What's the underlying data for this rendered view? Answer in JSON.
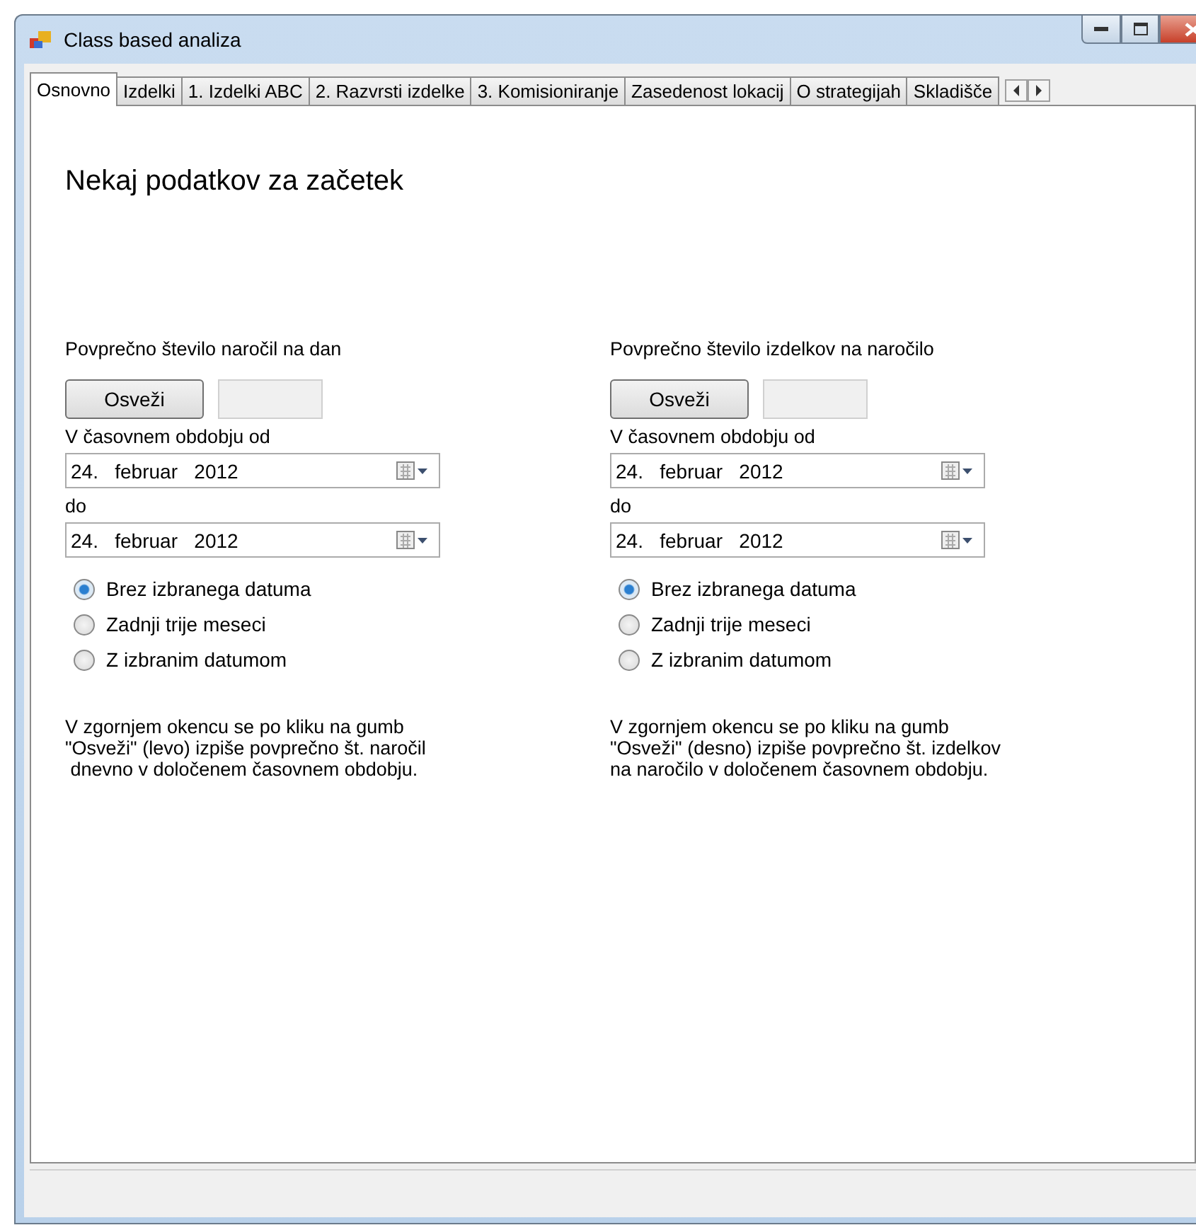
{
  "window": {
    "title": "Class based analiza"
  },
  "tabs": [
    {
      "label": "Osnovno",
      "selected": true
    },
    {
      "label": "Izdelki",
      "selected": false
    },
    {
      "label": "1. Izdelki ABC",
      "selected": false
    },
    {
      "label": "2. Razvrsti izdelke",
      "selected": false
    },
    {
      "label": "3. Komisioniranje",
      "selected": false
    },
    {
      "label": "Zasedenost lokacij",
      "selected": false
    },
    {
      "label": "O strategijah",
      "selected": false
    },
    {
      "label": "Skladišče",
      "selected": false
    }
  ],
  "heading": "Nekaj podatkov za začetek",
  "panels": [
    {
      "title": "Povprečno število naročil na dan",
      "button": "Osveži",
      "from_label": "V časovnem obdobju od",
      "from_date": "24.   februar   2012",
      "to_label": "do",
      "to_date": "24.   februar   2012",
      "options": [
        {
          "label": "Brez izbranega datuma",
          "selected": true
        },
        {
          "label": "Zadnji trije meseci",
          "selected": false
        },
        {
          "label": "Z izbranim datumom",
          "selected": false
        }
      ],
      "note": "V zgornjem okencu se po kliku na gumb\n\"Osveži\" (levo) izpiše povprečno št. naročil\n dnevno v določenem časovnem obdobju."
    },
    {
      "title": "Povprečno število izdelkov na naročilo",
      "button": "Osveži",
      "from_label": "V časovnem obdobju od",
      "from_date": "24.   februar   2012",
      "to_label": "do",
      "to_date": "24.   februar   2012",
      "options": [
        {
          "label": "Brez izbranega datuma",
          "selected": true
        },
        {
          "label": "Zadnji trije meseci",
          "selected": false
        },
        {
          "label": "Z izbranim datumom",
          "selected": false
        }
      ],
      "note": "V zgornjem okencu se po kliku na gumb\n\"Osveži\" (desno) izpiše povprečno št. izdelkov\nna naročilo v določenem časovnem obdobju."
    }
  ]
}
